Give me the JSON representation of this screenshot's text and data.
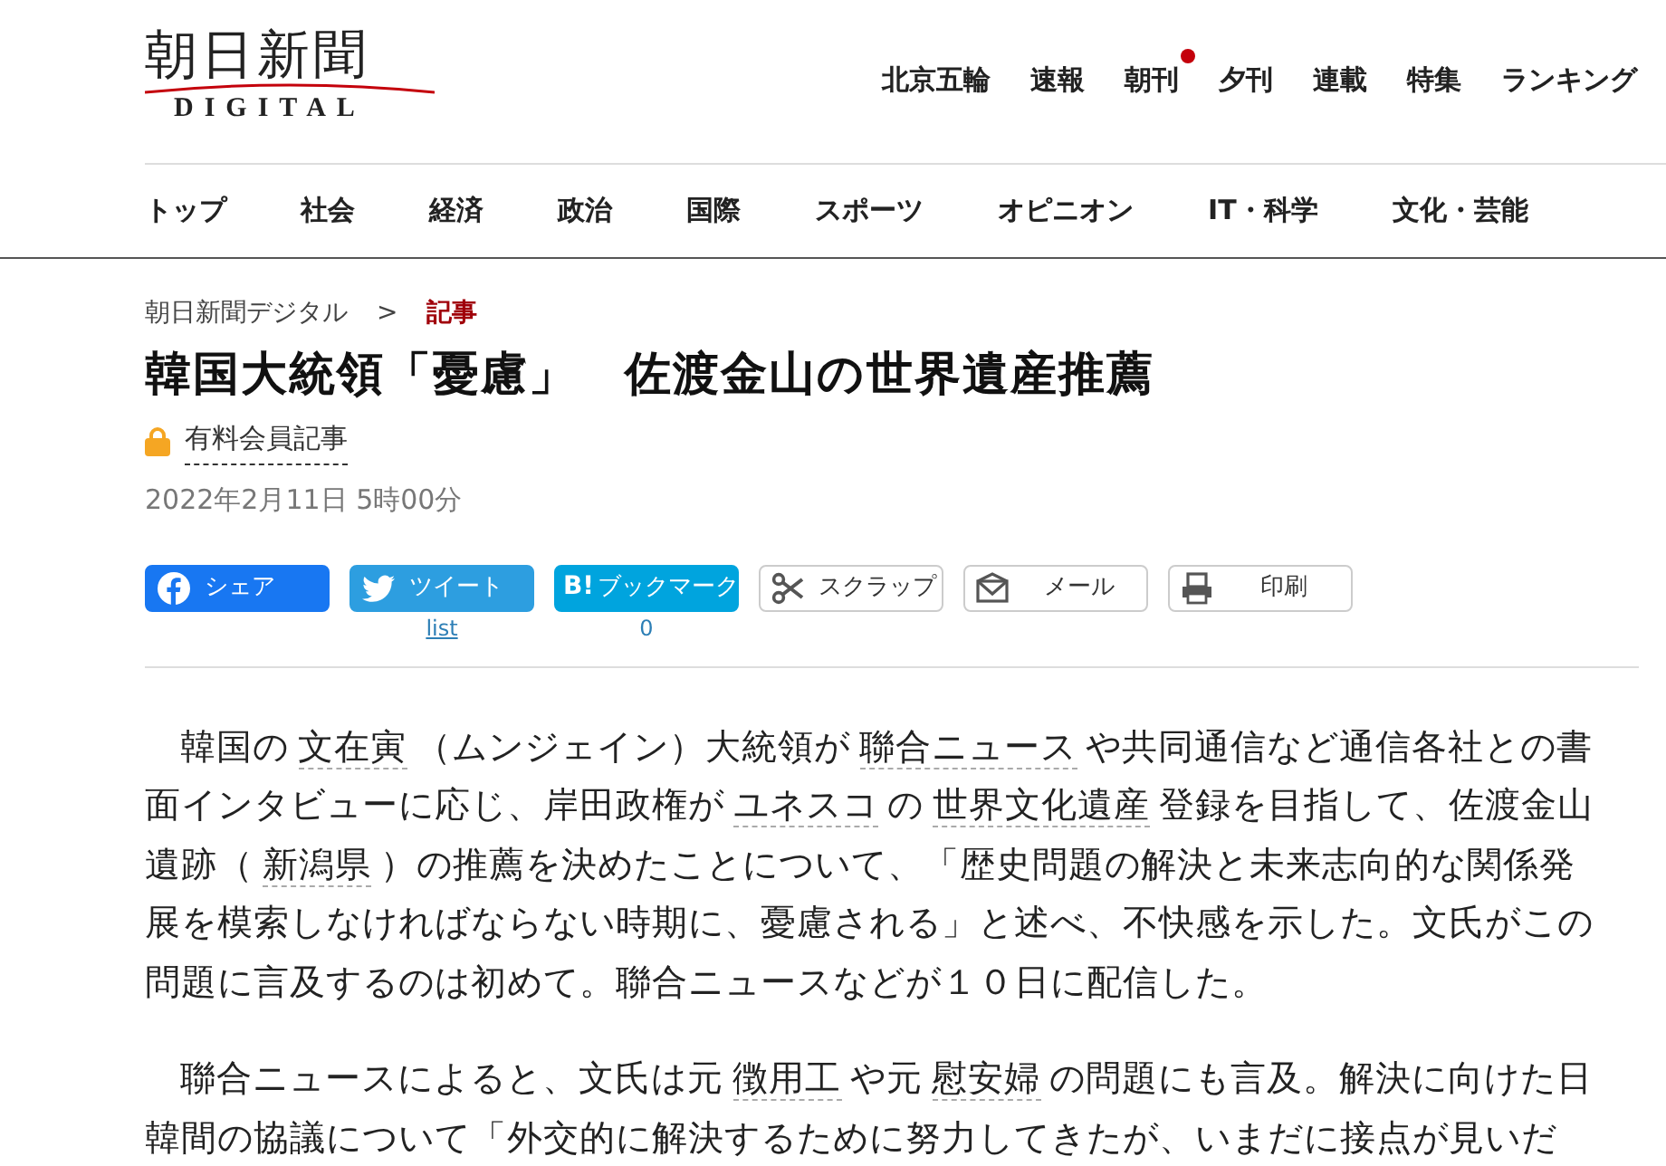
{
  "logo": {
    "title": "朝日新聞",
    "subtitle": "DIGITAL"
  },
  "top_links": [
    {
      "label": "北京五輪",
      "new": false
    },
    {
      "label": "速報",
      "new": false
    },
    {
      "label": "朝刊",
      "new": true
    },
    {
      "label": "夕刊",
      "new": false
    },
    {
      "label": "連載",
      "new": false
    },
    {
      "label": "特集",
      "new": false
    },
    {
      "label": "ランキング",
      "new": false
    }
  ],
  "nav": [
    "トップ",
    "社会",
    "経済",
    "政治",
    "国際",
    "スポーツ",
    "オピニオン",
    "IT・科学",
    "文化・芸能"
  ],
  "breadcrumb": {
    "separator": ">",
    "items": [
      {
        "label": "朝日新聞デジタル",
        "current": false
      },
      {
        "label": "記事",
        "current": true
      }
    ]
  },
  "title": "韓国大統領「憂慮」　佐渡金山の世界遺産推薦",
  "badge": "有料会員記事",
  "date": "2022年2月11日 5時00分",
  "share_buttons": [
    {
      "kind": "facebook",
      "label": "シェア"
    },
    {
      "kind": "twitter",
      "label": "ツイート",
      "count": "list"
    },
    {
      "kind": "hatena",
      "mark": "B!",
      "label": "ブックマーク",
      "count": "0"
    },
    {
      "kind": "scrap",
      "label": "スクラップ"
    },
    {
      "kind": "mail",
      "label": "メール"
    },
    {
      "kind": "print",
      "label": "印刷"
    }
  ],
  "paragraphs": [
    [
      "韓国の",
      {
        "link": "文在寅"
      },
      "（ムンジェイン）大統領が",
      {
        "link": "聯合ニュース"
      },
      "や共同通信など通信各社との書面インタビューに応じ、岸田政権が",
      {
        "link": "ユネスコ"
      },
      "の",
      {
        "link": "世界文化遺産"
      },
      "登録を目指して、佐渡金山遺跡（",
      {
        "link": "新潟県"
      },
      "）の推薦を決めたことについて、「歴史問題の解決と未来志向的な関係発展を模索しなければならない時期に、憂慮される」と述べ、不快感を示した。文氏がこの問題に言及するのは初めて。聯合ニュースなどが１０日に配信した。"
    ],
    [
      "聯合ニュースによると、文氏は元",
      {
        "link": "徴用工"
      },
      "や元",
      {
        "link": "慰安婦"
      },
      "の問題にも言及。解決に向けた日韓間の協議について「外交的に解決するために努力してきたが、いまだに接点が見いだ"
    ]
  ]
}
